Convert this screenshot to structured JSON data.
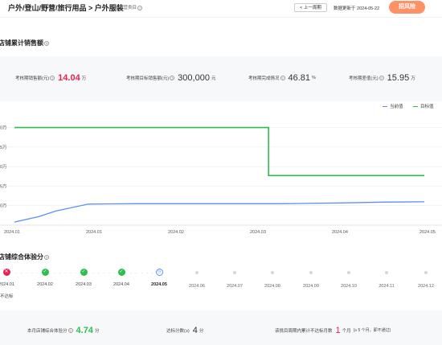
{
  "header": {
    "breadcrumb": "户外/登山/野营/旅行用品 > 户外服装",
    "sub_label": "考核主营类目",
    "help_icon": "?",
    "prev_cycle_button": "< 上一周期",
    "updated_text": "数据更新于 2024-05-22",
    "apply_button": "招风险"
  },
  "sales_section": {
    "title": "店铺累计销售额",
    "help_icon": "?",
    "kpis": [
      {
        "label": "考核期销售额(元)",
        "help": "?",
        "value": "14.04",
        "unit": "万",
        "highlight": true
      },
      {
        "label": "考核期目标销售额(元)",
        "help": "?",
        "value": "300,000",
        "unit": "元",
        "highlight": false
      },
      {
        "label": "考核期完成情况",
        "help": "?",
        "value": "46.81",
        "unit": "%",
        "highlight": false
      },
      {
        "label": "考核期差值(元)",
        "help": "?",
        "value": "15.95",
        "unit": "万",
        "highlight": false
      }
    ]
  },
  "chart_data": {
    "type": "line",
    "x_labels": [
      "2024.01",
      "2024.01",
      "2024.02",
      "2024.03",
      "2024.04",
      "2024.05"
    ],
    "y_tick_labels": [
      "0万",
      "5万",
      "0万",
      "5万",
      "0万"
    ],
    "y_ticks": [
      5,
      10,
      15,
      20,
      25
    ],
    "ylim": [
      0,
      28
    ],
    "grid": true,
    "legend": "top-right",
    "series": [
      {
        "name": "当前值",
        "color": "#5b8ff9",
        "points": [
          [
            0,
            0.8
          ],
          [
            0.06,
            2.2
          ],
          [
            0.1,
            3.6
          ],
          [
            0.18,
            5.4
          ],
          [
            0.3,
            5.5
          ],
          [
            0.45,
            5.5
          ],
          [
            0.65,
            5.5
          ],
          [
            0.8,
            5.7
          ],
          [
            0.9,
            5.9
          ],
          [
            1.0,
            6.0
          ]
        ]
      },
      {
        "name": "目标值",
        "color": "#2dbe4c",
        "points": [
          [
            0,
            25
          ],
          [
            0.62,
            25
          ],
          [
            0.62,
            12.7
          ],
          [
            1.0,
            12.7
          ]
        ]
      }
    ]
  },
  "score_section": {
    "title": "店铺综合体验分",
    "help_icon": "?",
    "timeline": [
      {
        "month": "2024.01",
        "status": "fail",
        "glyph": "✕"
      },
      {
        "month": "2024.02",
        "status": "ok",
        "glyph": "✓"
      },
      {
        "month": "2024.03",
        "status": "ok",
        "glyph": "✓"
      },
      {
        "month": "2024.04",
        "status": "ok",
        "glyph": "✓"
      },
      {
        "month": "2024.05",
        "status": "current",
        "glyph": "◷"
      },
      {
        "month": "2024.06",
        "status": "future",
        "glyph": ""
      },
      {
        "month": "2024.07",
        "status": "future",
        "glyph": ""
      },
      {
        "month": "2024.08",
        "status": "future",
        "glyph": ""
      },
      {
        "month": "2024.09",
        "status": "future",
        "glyph": ""
      },
      {
        "month": "2024.10",
        "status": "future",
        "glyph": ""
      },
      {
        "month": "2024.11",
        "status": "future",
        "glyph": ""
      },
      {
        "month": "2024.12",
        "status": "future",
        "glyph": ""
      }
    ],
    "first_note": "不达标",
    "dots": "· · · · ·",
    "stats": [
      {
        "label": "本月店铺综合体验分",
        "help": "?",
        "value": "4.74",
        "unit": "分",
        "hint": ""
      },
      {
        "label": "达标分数(≥)",
        "help": "",
        "value": "4",
        "unit": "分",
        "hint": ""
      },
      {
        "label": "该挑目周期内累计不达标月数",
        "help": "",
        "value": "1",
        "unit": "个月",
        "hint": "(≥ 5 个月，即不通过)"
      }
    ]
  }
}
